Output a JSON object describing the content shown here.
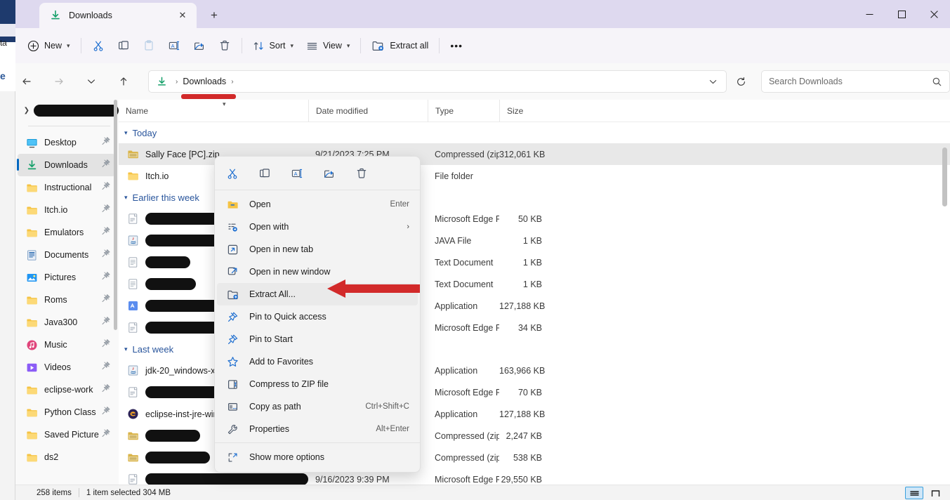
{
  "window": {
    "tab_title": "Downloads",
    "new_tab_label": "+",
    "minimize_label": "—",
    "maximize_label": "☐",
    "close_label": "✕"
  },
  "background_window": {
    "text_a": "ta",
    "text_b": "e"
  },
  "toolbar": {
    "new_label": "New",
    "cut_label": "Cut",
    "copy_label": "Copy",
    "paste_label": "Paste",
    "rename_label": "Rename",
    "share_label": "Share",
    "delete_label": "Delete",
    "sort_label": "Sort",
    "view_label": "View",
    "extract_all_label": "Extract all",
    "more_label": "•••"
  },
  "address": {
    "back_label": "←",
    "forward_label": "→",
    "recent_label": "⌄",
    "up_label": "↑",
    "crumb_downloads": "Downloads",
    "crumb_sep": "›",
    "dropdown_label": "⌄",
    "refresh_label": "⟳"
  },
  "search": {
    "placeholder": "Search Downloads",
    "value": ""
  },
  "sidebar": {
    "top_entry_redacted": true,
    "items": [
      {
        "label": "Desktop",
        "icon": "desktop-icon",
        "pinned": true,
        "selected": false
      },
      {
        "label": "Downloads",
        "icon": "download-icon",
        "pinned": true,
        "selected": true
      },
      {
        "label": "Instructional",
        "icon": "folder-icon",
        "pinned": true,
        "selected": false
      },
      {
        "label": "Itch.io",
        "icon": "folder-icon",
        "pinned": true,
        "selected": false
      },
      {
        "label": "Emulators",
        "icon": "folder-icon",
        "pinned": true,
        "selected": false
      },
      {
        "label": "Documents",
        "icon": "document-icon",
        "pinned": true,
        "selected": false
      },
      {
        "label": "Pictures",
        "icon": "pictures-icon",
        "pinned": true,
        "selected": false
      },
      {
        "label": "Roms",
        "icon": "folder-icon",
        "pinned": true,
        "selected": false
      },
      {
        "label": "Java300",
        "icon": "folder-icon",
        "pinned": true,
        "selected": false
      },
      {
        "label": "Music",
        "icon": "music-icon",
        "pinned": true,
        "selected": false
      },
      {
        "label": "Videos",
        "icon": "video-icon",
        "pinned": true,
        "selected": false
      },
      {
        "label": "eclipse-work",
        "icon": "folder-icon",
        "pinned": true,
        "selected": false
      },
      {
        "label": "Python Class",
        "icon": "folder-icon",
        "pinned": true,
        "selected": false
      },
      {
        "label": "Saved Picture",
        "icon": "folder-icon",
        "pinned": true,
        "selected": false
      },
      {
        "label": "ds2",
        "icon": "folder-icon",
        "pinned": false,
        "selected": false
      }
    ]
  },
  "columns": {
    "name": "Name",
    "date_modified": "Date modified",
    "type": "Type",
    "size": "Size"
  },
  "groups": [
    {
      "label": "Today",
      "rows": [
        {
          "name": "Sally Face [PC].zip",
          "redacted": false,
          "icon": "zip-icon",
          "date": "9/21/2023 7:25 PM",
          "type": "Compressed (zipp...",
          "size": "312,061 KB",
          "selected": true
        },
        {
          "name": "Itch.io",
          "redacted": false,
          "icon": "folder-icon",
          "date": "",
          "type": "File folder",
          "size": "",
          "selected": false
        }
      ]
    },
    {
      "label": "Earlier this week",
      "rows": [
        {
          "name": "",
          "redacted": true,
          "redact_width": 134,
          "icon": "edge-icon",
          "date": "",
          "type": "Microsoft Edge P...",
          "size": "50 KB",
          "selected": false
        },
        {
          "name": "",
          "redacted": true,
          "redact_width": 132,
          "icon": "java-icon",
          "date": "",
          "type": "JAVA File",
          "size": "1 KB",
          "selected": false
        },
        {
          "name": "",
          "redacted": true,
          "redact_width": 64,
          "icon": "text-icon",
          "date": "",
          "type": "Text Document",
          "size": "1 KB",
          "selected": false
        },
        {
          "name": "",
          "redacted": true,
          "redact_width": 72,
          "icon": "text-icon",
          "date": "",
          "type": "Text Document",
          "size": "1 KB",
          "selected": false
        },
        {
          "name": "",
          "redacted": true,
          "redact_width": 138,
          "icon": "app-icon",
          "date": "",
          "type": "Application",
          "size": "127,188 KB",
          "selected": false
        },
        {
          "name": "",
          "redacted": true,
          "redact_width": 132,
          "icon": "edge-icon",
          "date": "",
          "type": "Microsoft Edge P...",
          "size": "34 KB",
          "selected": false
        }
      ]
    },
    {
      "label": "Last week",
      "rows": [
        {
          "name": "jdk-20_windows-x6",
          "redacted": false,
          "icon": "java-icon",
          "date": "",
          "type": "Application",
          "size": "163,966 KB",
          "selected": false
        },
        {
          "name": "",
          "redacted": true,
          "redact_width": 136,
          "icon": "edge-icon",
          "date": "",
          "type": "Microsoft Edge P...",
          "size": "70 KB",
          "selected": false
        },
        {
          "name": "eclipse-inst-jre-win",
          "redacted": false,
          "icon": "eclipse-icon",
          "date": "",
          "type": "Application",
          "size": "127,188 KB",
          "selected": false
        },
        {
          "name": "",
          "redacted": true,
          "redact_width": 78,
          "icon": "zip-icon",
          "date": "",
          "type": "Compressed (zipp...",
          "size": "2,247 KB",
          "selected": false
        },
        {
          "name": "",
          "redacted": true,
          "redact_width": 92,
          "icon": "zip-icon",
          "date": "",
          "type": "Compressed (zipp...",
          "size": "538 KB",
          "selected": false
        },
        {
          "name": "",
          "redacted": true,
          "redact_width": 262,
          "icon": "edge-icon",
          "date": "9/16/2023 9:39 PM",
          "type": "Microsoft Edge P...",
          "size": "29,550 KB",
          "selected": false
        }
      ]
    }
  ],
  "context_menu": {
    "icon_row": [
      {
        "name": "cut-icon",
        "label": "Cut"
      },
      {
        "name": "copy-icon",
        "label": "Copy"
      },
      {
        "name": "rename-icon",
        "label": "Rename"
      },
      {
        "name": "share-icon",
        "label": "Share"
      },
      {
        "name": "delete-icon",
        "label": "Delete"
      }
    ],
    "items": [
      {
        "label": "Open",
        "accel": "Enter",
        "submenu": false,
        "highlighted": false,
        "icon": "open-folder-icon"
      },
      {
        "label": "Open with",
        "accel": "",
        "submenu": true,
        "highlighted": false,
        "icon": "open-with-icon"
      },
      {
        "label": "Open in new tab",
        "accel": "",
        "submenu": false,
        "highlighted": false,
        "icon": "new-tab-icon"
      },
      {
        "label": "Open in new window",
        "accel": "",
        "submenu": false,
        "highlighted": false,
        "icon": "new-window-icon"
      },
      {
        "label": "Extract All...",
        "accel": "",
        "submenu": false,
        "highlighted": true,
        "icon": "extract-icon"
      },
      {
        "label": "Pin to Quick access",
        "accel": "",
        "submenu": false,
        "highlighted": false,
        "icon": "pin-icon"
      },
      {
        "label": "Pin to Start",
        "accel": "",
        "submenu": false,
        "highlighted": false,
        "icon": "pin-icon"
      },
      {
        "label": "Add to Favorites",
        "accel": "",
        "submenu": false,
        "highlighted": false,
        "icon": "star-icon"
      },
      {
        "label": "Compress to ZIP file",
        "accel": "",
        "submenu": false,
        "highlighted": false,
        "icon": "compress-icon"
      },
      {
        "label": "Copy as path",
        "accel": "Ctrl+Shift+C",
        "submenu": false,
        "highlighted": false,
        "icon": "copy-path-icon"
      },
      {
        "label": "Properties",
        "accel": "Alt+Enter",
        "submenu": false,
        "highlighted": false,
        "icon": "properties-icon"
      }
    ],
    "more_options_label": "Show more options",
    "more_options_icon": "show-more-icon"
  },
  "annotations": {
    "arrow_color": "#d22a2a",
    "underline_color": "#d22a2a",
    "arrow_points_to": "Extract All..."
  },
  "status": {
    "item_count": "258 items",
    "selection": "1 item selected  304 MB",
    "view_details_label": "Details view",
    "view_icons_label": "Large icons view"
  }
}
